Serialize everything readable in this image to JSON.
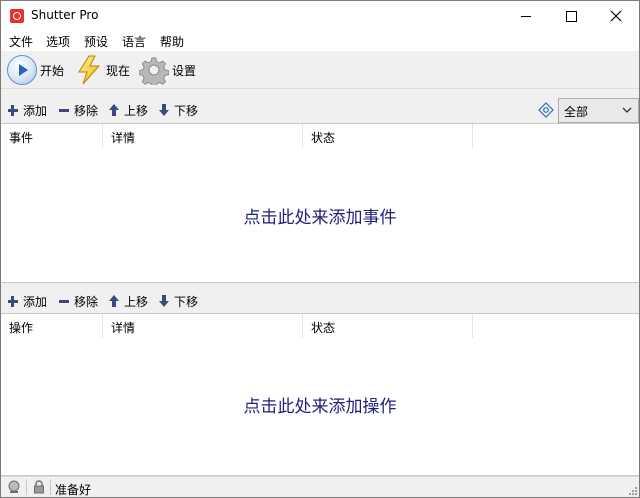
{
  "window": {
    "title": "Shutter Pro",
    "controls": [
      "minimize",
      "maximize",
      "close"
    ]
  },
  "menu": {
    "items": [
      "文件",
      "选项",
      "预设",
      "语言",
      "帮助"
    ]
  },
  "toolbar": {
    "start_label": "开始",
    "now_label": "现在",
    "settings_label": "设置"
  },
  "events": {
    "toolbar": {
      "add": "添加",
      "remove": "移除",
      "move_up": "上移",
      "move_down": "下移"
    },
    "filter": {
      "selected": "全部"
    },
    "columns": [
      "事件",
      "详情",
      "状态"
    ],
    "placeholder": "点击此处来添加事件"
  },
  "actions": {
    "toolbar": {
      "add": "添加",
      "remove": "移除",
      "move_up": "上移",
      "move_down": "下移"
    },
    "columns": [
      "操作",
      "详情",
      "状态"
    ],
    "placeholder": "点击此处来添加操作"
  },
  "status": {
    "text": "准备好"
  },
  "colors": {
    "placeholder_text": "#1e237a",
    "toolbar_icon": "#3a4a7a",
    "app_icon": "#e8312a"
  }
}
